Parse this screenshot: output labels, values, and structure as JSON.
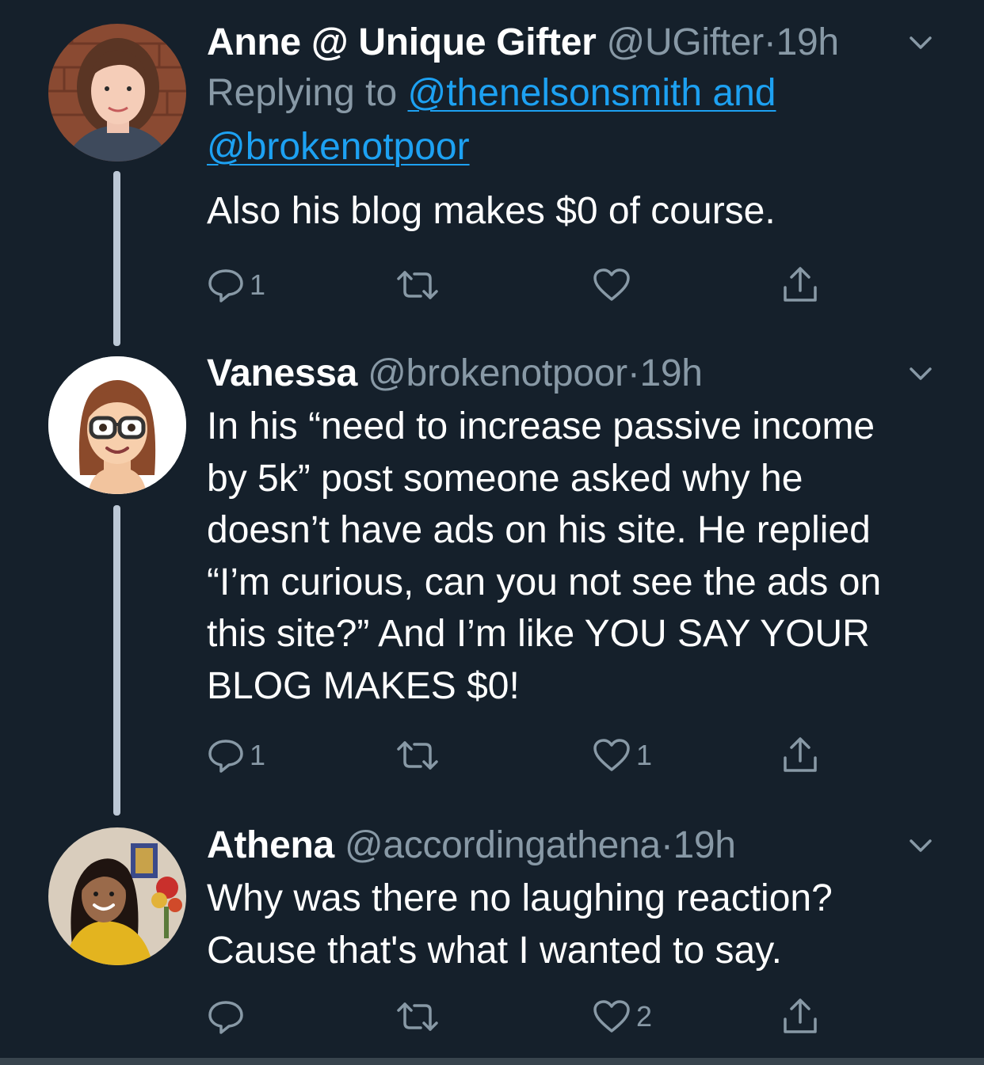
{
  "tweets": [
    {
      "name": "Anne @ Unique Gifter",
      "handle": "@UGifter",
      "separator": "·",
      "time": "19h",
      "replying_prefix": "Replying to ",
      "replying_line1": "@thenelsonsmith and",
      "replying_line2": "@brokenotpoor",
      "text": "Also his blog makes $0 of course.",
      "reply_count": "1",
      "retweet_count": "",
      "like_count": ""
    },
    {
      "name": "Vanessa",
      "handle": "@brokenotpoor",
      "separator": "·",
      "time": "19h",
      "text_lines": [
        "In his “need to increase passive income",
        "by 5k” post someone asked why he",
        "doesn’t have ads on his site. He replied",
        "“I’m curious, can you not see the ads on",
        "this site?” And I’m like YOU SAY YOUR",
        "BLOG MAKES $0!"
      ],
      "reply_count": "1",
      "retweet_count": "",
      "like_count": "1"
    },
    {
      "name": "Athena",
      "handle": "@accordingathena",
      "separator": "·",
      "time": "19h",
      "text_lines": [
        "Why was there no laughing reaction?",
        "Cause that's what I wanted to say."
      ],
      "reply_count": "",
      "retweet_count": "",
      "like_count": "2"
    }
  ],
  "icons": [
    "reply-icon",
    "retweet-icon",
    "like-icon",
    "share-icon",
    "chevron-down-icon"
  ],
  "colors": {
    "background": "#15202b",
    "text": "#ffffff",
    "muted": "#8899a6",
    "link": "#1da1f2",
    "thread_line": "#bcc8d6"
  }
}
